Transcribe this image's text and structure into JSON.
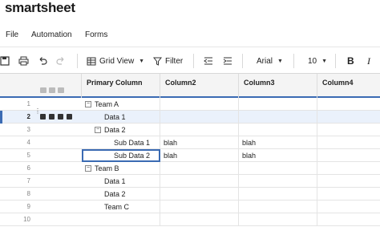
{
  "app": {
    "brand": "smartsheet"
  },
  "menu": {
    "items": [
      "File",
      "Automation",
      "Forms"
    ]
  },
  "toolbar": {
    "grid_view_label": "Grid View",
    "filter_label": "Filter",
    "font_name": "Arial",
    "font_size": "10",
    "bold_label": "B",
    "italic_label": "I"
  },
  "grid": {
    "columns": [
      "Primary Column",
      "Column2",
      "Column3",
      "Column4"
    ],
    "active_row": 2,
    "selected_row": 5,
    "rows": [
      {
        "num": "1",
        "primary": "Team A",
        "col2": "",
        "col3": "",
        "col4": "",
        "indent": 0,
        "collapsible": true
      },
      {
        "num": "2",
        "primary": "Data 1",
        "col2": "",
        "col3": "",
        "col4": "",
        "indent": 1,
        "collapsible": false
      },
      {
        "num": "3",
        "primary": "Data 2",
        "col2": "",
        "col3": "",
        "col4": "",
        "indent": 1,
        "collapsible": true
      },
      {
        "num": "4",
        "primary": "Sub Data 1",
        "col2": "blah",
        "col3": "blah",
        "col4": "",
        "indent": 2,
        "collapsible": false
      },
      {
        "num": "5",
        "primary": "Sub Data 2",
        "col2": "blah",
        "col3": "blah",
        "col4": "",
        "indent": 2,
        "collapsible": false
      },
      {
        "num": "6",
        "primary": "Team B",
        "col2": "",
        "col3": "",
        "col4": "",
        "indent": 0,
        "collapsible": true
      },
      {
        "num": "7",
        "primary": "Data 1",
        "col2": "",
        "col3": "",
        "col4": "",
        "indent": 1,
        "collapsible": false
      },
      {
        "num": "8",
        "primary": "Data 2",
        "col2": "",
        "col3": "",
        "col4": "",
        "indent": 1,
        "collapsible": false
      },
      {
        "num": "9",
        "primary": "Team C",
        "col2": "",
        "col3": "",
        "col4": "",
        "indent": 1,
        "collapsible": false
      },
      {
        "num": "10",
        "primary": "",
        "col2": "",
        "col3": "",
        "col4": "",
        "indent": 0,
        "collapsible": false
      }
    ]
  },
  "colors": {
    "accent": "#3b6bb3",
    "active_row": "#eaf1fb"
  }
}
